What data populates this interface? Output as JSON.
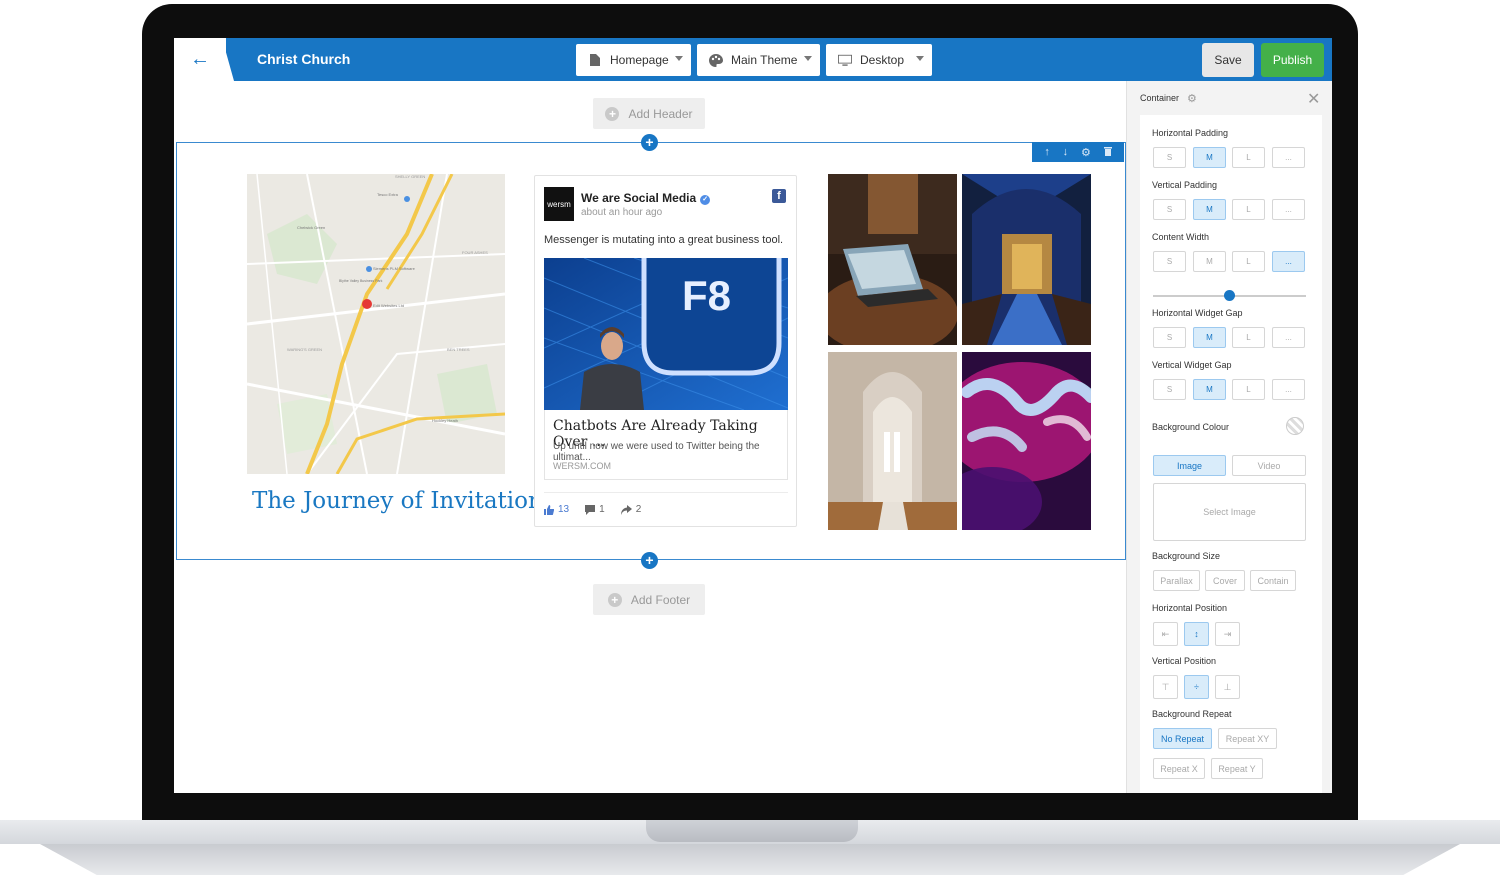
{
  "topbar": {
    "site_title": "Christ Church",
    "page_select": "Homepage",
    "theme_select": "Main Theme",
    "device_select": "Desktop",
    "save_label": "Save",
    "publish_label": "Publish"
  },
  "canvas": {
    "add_header_label": "Add Header",
    "add_footer_label": "Add Footer",
    "map_labels": [
      "SHELLY GREEN",
      "Tesco Extra",
      "Chelwick Green",
      "Siemens PLM Software",
      "Blythe Valley Business Park",
      "FOUR ASHES",
      "Edit Websites Ltd",
      "WARING'S GREEN",
      "BEN TREES",
      "Hockley Heath"
    ],
    "journey_title": "The Journey of Invitation",
    "fb_post": {
      "logo_text": "wersm",
      "author": "We are Social Media",
      "time": "about an hour ago",
      "message": "Messenger is mutating into a great business tool.",
      "image_text": "F8",
      "link_title": "Chatbots Are Already Taking Over ...",
      "link_desc": "Up until now we were used to Twitter being the ultimat...",
      "link_source": "WERSM.COM",
      "likes": "13",
      "comments": "1",
      "shares": "2"
    }
  },
  "panel": {
    "title": "Container",
    "horizontal_padding": {
      "label": "Horizontal Padding",
      "options": [
        "S",
        "M",
        "L",
        "..."
      ],
      "selected": "M"
    },
    "vertical_padding": {
      "label": "Vertical Padding",
      "options": [
        "S",
        "M",
        "L",
        "..."
      ],
      "selected": "M"
    },
    "content_width": {
      "label": "Content Width",
      "options": [
        "S",
        "M",
        "L",
        "..."
      ],
      "selected": "...",
      "slider_value": 0.5
    },
    "horizontal_widget_gap": {
      "label": "Horizontal Widget Gap",
      "options": [
        "S",
        "M",
        "L",
        "..."
      ],
      "selected": "M"
    },
    "vertical_widget_gap": {
      "label": "Vertical Widget Gap",
      "options": [
        "S",
        "M",
        "L",
        "..."
      ],
      "selected": "M"
    },
    "background_colour_label": "Background Colour",
    "bg_type": {
      "image": "Image",
      "video": "Video",
      "selected": "Image"
    },
    "select_image_label": "Select Image",
    "background_size": {
      "label": "Background Size",
      "options": [
        "Parallax",
        "Cover",
        "Contain"
      ]
    },
    "horizontal_position": {
      "label": "Horizontal Position",
      "selected": "center"
    },
    "vertical_position": {
      "label": "Vertical Position",
      "selected": "center"
    },
    "background_repeat": {
      "label": "Background Repeat",
      "options": [
        "No Repeat",
        "Repeat XY",
        "Repeat X",
        "Repeat Y"
      ],
      "selected": "No Repeat"
    }
  },
  "colors": {
    "brand_blue": "#1876c4",
    "publish_green": "#44b049"
  }
}
